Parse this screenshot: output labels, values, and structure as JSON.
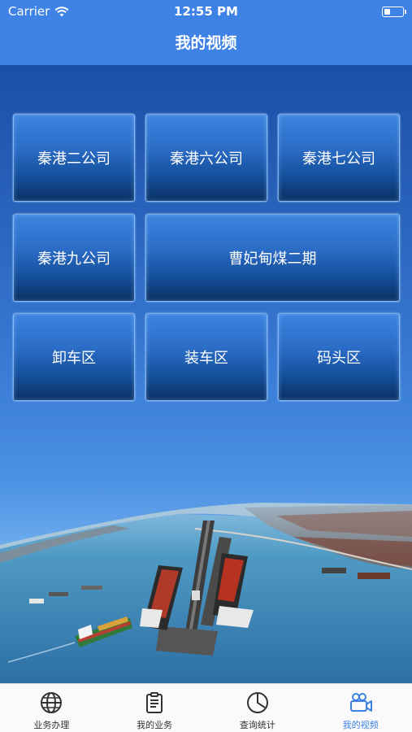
{
  "status_bar": {
    "carrier": "Carrier",
    "time": "12:55 PM",
    "battery_level": 0.35
  },
  "nav": {
    "title": "我的视频"
  },
  "tiles": [
    {
      "label": "秦港二公司"
    },
    {
      "label": "秦港六公司"
    },
    {
      "label": "秦港七公司"
    },
    {
      "label": "秦港九公司"
    },
    {
      "label": "曹妃甸煤二期"
    },
    {
      "label": "卸车区"
    },
    {
      "label": "装车区"
    },
    {
      "label": "码头区"
    }
  ],
  "tabbar": {
    "items": [
      {
        "label": "业务办理",
        "icon": "globe-icon",
        "active": false
      },
      {
        "label": "我的业务",
        "icon": "clipboard-icon",
        "active": false
      },
      {
        "label": "查询统计",
        "icon": "pie-chart-icon",
        "active": false
      },
      {
        "label": "我的视频",
        "icon": "video-camera-icon",
        "active": true
      }
    ]
  },
  "colors": {
    "header": "#3f82e6",
    "tab_active": "#3f82e6",
    "tab_inactive": "#333333"
  }
}
